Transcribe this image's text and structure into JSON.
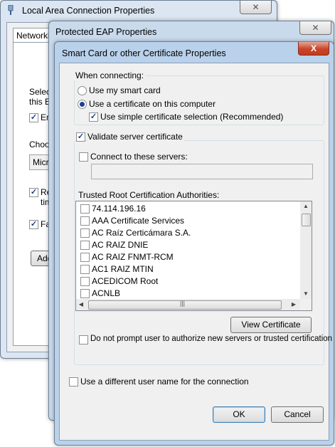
{
  "lac_window": {
    "title": "Local Area Connection Properties",
    "tab_label": "Networking",
    "partial_select": "Select",
    "partial_this": "this Et",
    "partial_ena": "Ena",
    "partial_choose": "Choos",
    "partial_dropdown": "Micro",
    "partial_re": "Re",
    "partial_tim": "tim",
    "partial_fa": "Fa",
    "partial_add": "Add"
  },
  "peap_window": {
    "title": "Protected EAP Properties"
  },
  "dialog": {
    "title": "Smart Card or other Certificate Properties",
    "close_label": "X",
    "when_connecting_label": "When connecting:",
    "use_smart_card_label": "Use my smart card",
    "use_certificate_label": "Use a certificate on this computer",
    "simple_selection_label": "Use simple certificate selection (Recommended)",
    "validate_label": "Validate server certificate",
    "connect_servers_label": "Connect to these servers:",
    "servers_value": "",
    "trusted_root_label": "Trusted Root Certification Authorities:",
    "cert_list": [
      "74.114.196.16",
      "AAA Certificate Services",
      "AC Raíz Certicámara S.A.",
      "AC RAIZ DNIE",
      "AC RAIZ FNMT-RCM",
      "AC1 RAIZ MTIN",
      "ACEDICOM Root",
      "ACNLB"
    ],
    "view_cert_label": "View Certificate",
    "no_prompt_label": "Do not prompt user to authorize new servers or trusted certification",
    "diff_user_label": "Use a different user name for the connection",
    "ok_label": "OK",
    "cancel_label": "Cancel"
  },
  "colors": {
    "checkmark": "#1b3f91",
    "close_red": "#c7452b",
    "frame": "#b9d1ea"
  }
}
